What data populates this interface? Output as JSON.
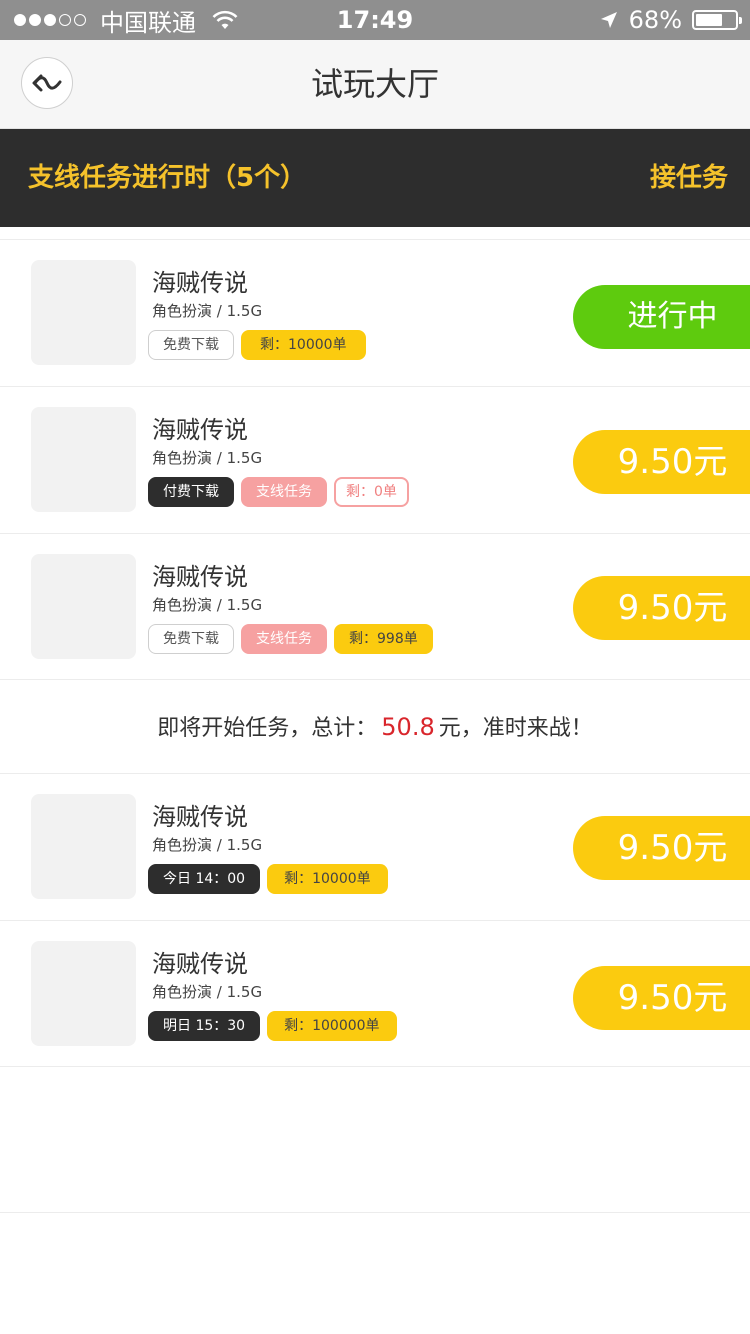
{
  "status_bar": {
    "carrier": "中国联通",
    "time": "17:49",
    "battery": "68%",
    "battery_level": 0.68
  },
  "nav": {
    "title": "试玩大厅",
    "back_icon": "back-arrow-icon"
  },
  "banner": {
    "title": "支线任务进行时（5个）",
    "accept": "接任务"
  },
  "items": [
    {
      "title": "海贼传说",
      "meta": "角色扮演 / 1.5G",
      "tags": [
        "免费下载",
        "剩：10000单"
      ],
      "action": "进行中"
    },
    {
      "title": "海贼传说",
      "meta": "角色扮演 / 1.5G",
      "tags": [
        "付费下载",
        "支线任务",
        "剩：0单"
      ],
      "action": "9.50元"
    },
    {
      "title": "海贼传说",
      "meta": "角色扮演 / 1.5G",
      "tags": [
        "免费下载",
        "支线任务",
        "剩：998单"
      ],
      "action": "9.50元"
    },
    {
      "title": "海贼传说",
      "meta": "角色扮演 / 1.5G",
      "tags": [
        "今日 14：00",
        "剩：10000单"
      ],
      "action": "9.50元"
    },
    {
      "title": "海贼传说",
      "meta": "角色扮演 / 1.5G",
      "tags": [
        "明日 15：30",
        "剩：100000单"
      ],
      "action": "9.50元"
    }
  ],
  "notice": {
    "prefix": "即将开始任务，总计：",
    "amount": "50.8",
    "suffix": "元，准时来战！"
  },
  "colors": {
    "accent_yellow": "#fbcb0f",
    "banner_text": "#f5c22b",
    "in_progress_green": "#5ecb0e",
    "dark": "#2d2d2d",
    "pink": "#f6a1a1",
    "amount_red": "#d9262c"
  }
}
